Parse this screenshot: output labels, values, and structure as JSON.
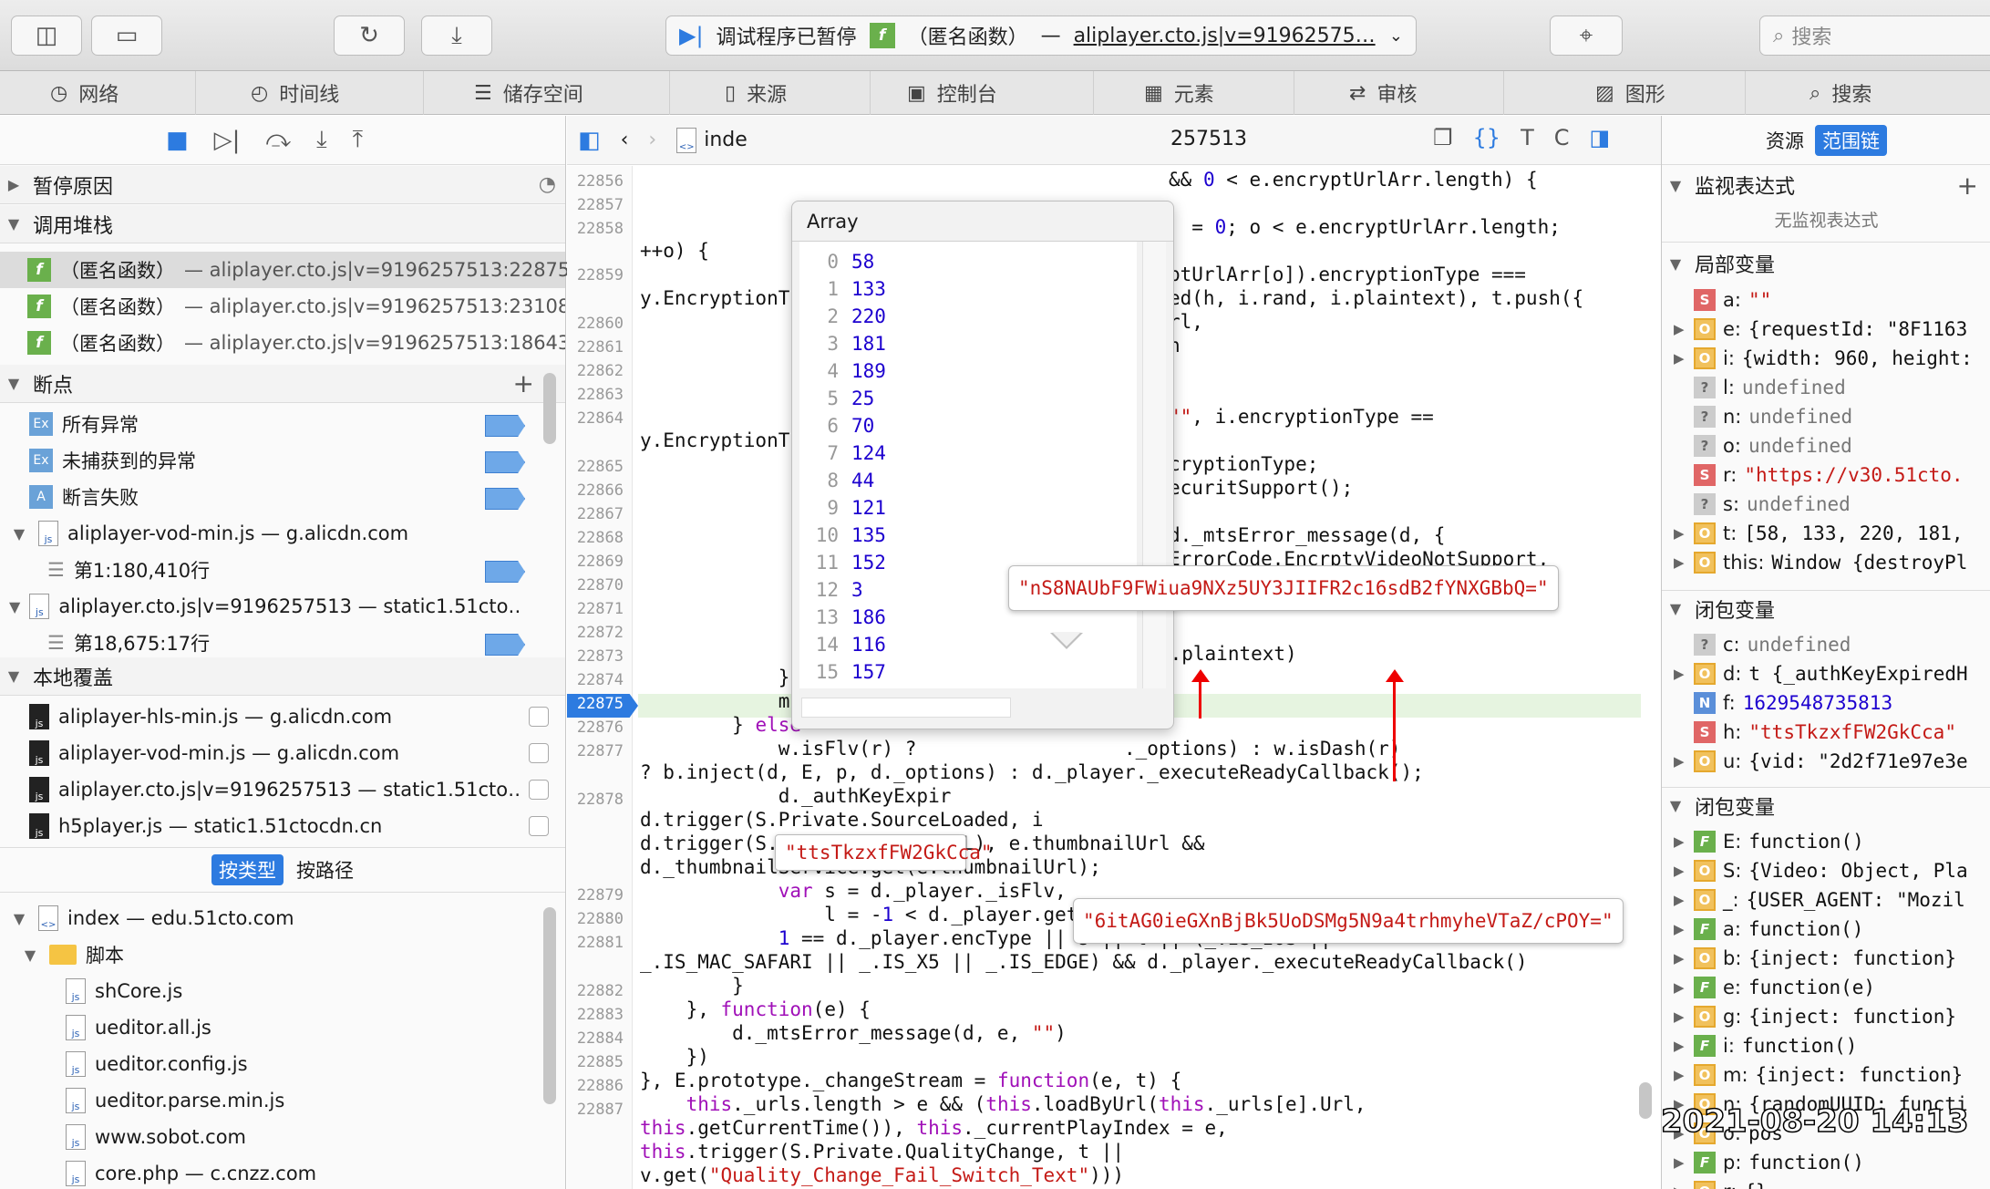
{
  "toolbar": {
    "status": "调试程序已暂停",
    "frame_func": "（匿名函数）",
    "frame_sep": "—",
    "frame_file": "aliplayer.cto.js|v=91962575…",
    "search_placeholder": "搜索"
  },
  "tabs": [
    {
      "label": "网络"
    },
    {
      "label": "时间线"
    },
    {
      "label": "储存空间"
    },
    {
      "label": "来源"
    },
    {
      "label": "控制台"
    },
    {
      "label": "元素"
    },
    {
      "label": "审核"
    },
    {
      "label": "图形"
    },
    {
      "label": "搜索"
    }
  ],
  "left": {
    "pause_reason": "暂停原因",
    "call_stack": "调用堆栈",
    "frames": [
      {
        "name": "（匿名函数）",
        "loc": "— aliplayer.cto.js|v=9196257513:22875"
      },
      {
        "name": "（匿名函数）",
        "loc": "— aliplayer.cto.js|v=9196257513:23108"
      },
      {
        "name": "（匿名函数）",
        "loc": "— aliplayer.cto.js|v=9196257513:18643"
      }
    ],
    "breakpoints": "断点",
    "bp_items": [
      "所有异常",
      "未捕获到的异常",
      "断言失败"
    ],
    "bp_file1": "aliplayer-vod-min.js — g.alicdn.com",
    "bp_file1_line": "第1:180,410行",
    "bp_file2": "aliplayer.cto.js|v=9196257513 — static1.51cto…",
    "bp_file2_line": "第18,675:17行",
    "overrides": "本地覆盖",
    "override_files": [
      "aliplayer-hls-min.js — g.alicdn.com",
      "aliplayer-vod-min.js — g.alicdn.com",
      "aliplayer.cto.js|v=9196257513 — static1.51cto…",
      "h5player.js — static1.51ctocdn.cn"
    ],
    "group_type": "按类型",
    "group_path": "按路径",
    "tree_root": "index — edu.51cto.com",
    "tree_folder": "脚本",
    "tree_files": [
      "shCore.js",
      "ueditor.all.js",
      "ueditor.config.js",
      "ueditor.parse.min.js",
      "www.sobot.com",
      "core.php — c.cnzz.com"
    ]
  },
  "editor": {
    "tab_name": "inde",
    "tab_suffix": "257513"
  },
  "popup": {
    "title": "Array",
    "items": [
      [
        "0",
        "58"
      ],
      [
        "1",
        "133"
      ],
      [
        "2",
        "220"
      ],
      [
        "3",
        "181"
      ],
      [
        "4",
        "189"
      ],
      [
        "5",
        "25"
      ],
      [
        "6",
        "70"
      ],
      [
        "7",
        "124"
      ],
      [
        "8",
        "44"
      ],
      [
        "9",
        "121"
      ],
      [
        "10",
        "135"
      ],
      [
        "11",
        "152"
      ],
      [
        "12",
        "3"
      ],
      [
        "13",
        "186"
      ],
      [
        "14",
        "116"
      ],
      [
        "15",
        "157"
      ]
    ]
  },
  "annotations": {
    "value1": "\"nS8NAUbF9FWiua9NXz5UY3JIIFR2c16sdB2fYNXGBbQ=\"",
    "value2": "\"ttsTkzxfFW2GkCca\"",
    "value3": "\"6itAG0ieGXnBjBk5UoDSMg5N9a4trhmyheVTaZ/cPOY=\""
  },
  "line_numbers": [
    "22856",
    "22857",
    "22858",
    "22859",
    "22860",
    "22861",
    "22862",
    "22863",
    "22864",
    "22865",
    "22866",
    "22867",
    "22868",
    "22869",
    "22870",
    "22871",
    "22872",
    "22873",
    "22874",
    "22875",
    "22876",
    "22877",
    "22878",
    "22879",
    "22880",
    "22881",
    "22882",
    "22883",
    "22884",
    "22885",
    "22886",
    "22887"
  ],
  "right": {
    "tab_resources": "资源",
    "tab_scope": "范围链",
    "watch": "监视表达式",
    "no_watch": "无监视表达式",
    "locals": "局部变量",
    "local_vars": [
      {
        "t": "S",
        "k": "a:",
        "v": "\"\""
      },
      {
        "t": "O",
        "k": "e:",
        "v": "{requestId: \"8F1163"
      },
      {
        "t": "O",
        "k": "i:",
        "v": "{width: 960, height:"
      },
      {
        "t": "?",
        "k": "l:",
        "v": "undefined"
      },
      {
        "t": "?",
        "k": "n:",
        "v": "undefined"
      },
      {
        "t": "?",
        "k": "o:",
        "v": "undefined"
      },
      {
        "t": "S",
        "k": "r:",
        "v": "\"https://v30.51cto."
      },
      {
        "t": "?",
        "k": "s:",
        "v": "undefined"
      },
      {
        "t": "O",
        "k": "t:",
        "v": "[58, 133, 220, 181,"
      },
      {
        "t": "O",
        "k": "this:",
        "v": "Window {destroyPl"
      }
    ],
    "closure1": "闭包变量",
    "closure1_vars": [
      {
        "t": "?",
        "k": "c:",
        "v": "undefined"
      },
      {
        "t": "O",
        "k": "d:",
        "v": "t {_authKeyExpiredH"
      },
      {
        "t": "N",
        "k": "f:",
        "v": "1629548735813"
      },
      {
        "t": "S",
        "k": "h:",
        "v": "\"ttsTkzxfFW2GkCca\""
      },
      {
        "t": "O",
        "k": "u:",
        "v": "{vid: \"2d2f71e97e3e"
      }
    ],
    "closure2": "闭包变量",
    "closure2_vars": [
      {
        "t": "F",
        "k": "E:",
        "v": "function()"
      },
      {
        "t": "O",
        "k": "S:",
        "v": "{Video: Object, Pla"
      },
      {
        "t": "O",
        "k": "_:",
        "v": "{USER_AGENT: \"Mozil"
      },
      {
        "t": "F",
        "k": "a:",
        "v": "function()"
      },
      {
        "t": "O",
        "k": "b:",
        "v": "{inject: function}"
      },
      {
        "t": "F",
        "k": "e:",
        "v": "function(e)"
      },
      {
        "t": "O",
        "k": "g:",
        "v": "{inject: function}"
      },
      {
        "t": "F",
        "k": "i:",
        "v": "function()"
      },
      {
        "t": "O",
        "k": "m:",
        "v": "{inject: function}"
      },
      {
        "t": "O",
        "k": "n:",
        "v": "{randomUUID: functi"
      },
      {
        "t": "O",
        "k": "o:",
        "v": "pos"
      },
      {
        "t": "F",
        "k": "p:",
        "v": "function()"
      },
      {
        "t": "O",
        "k": "r:",
        "v": "{}"
      }
    ],
    "timestamp": "2021-08-20 14:13"
  }
}
